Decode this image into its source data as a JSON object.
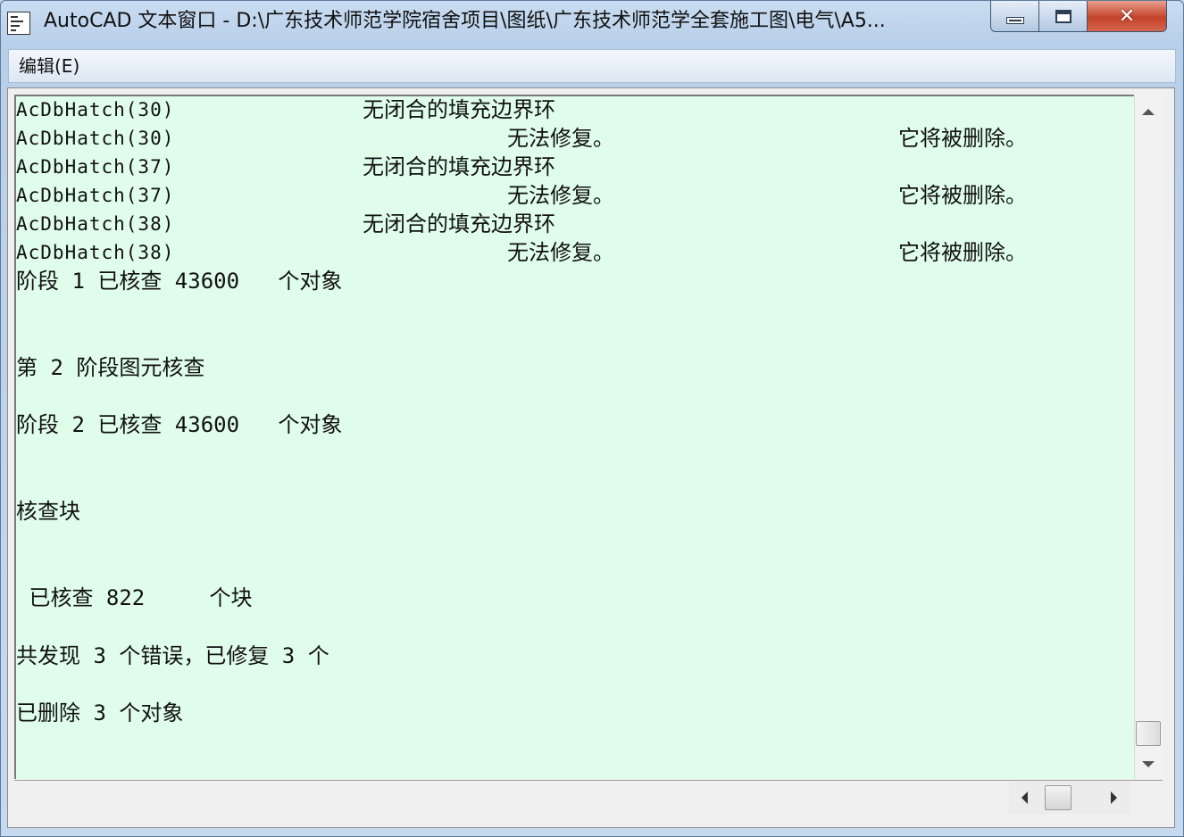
{
  "window": {
    "title": "AutoCAD 文本窗口 - D:\\广东技术师范学院宿舍项目\\图纸\\广东技术师范学全套施工图\\电气\\A5...",
    "title_icon": "text-window-icon",
    "min_icon": "minimize-icon",
    "max_icon": "maximize-icon",
    "close_icon": "close-icon",
    "close_glyph": "✕"
  },
  "menu": {
    "edit_label": "编辑(E)"
  },
  "console": {
    "lines": [
      {
        "a": "AcDbHatch(30)",
        "b": "无闭合的填充边界环",
        "c": ""
      },
      {
        "a": "AcDbHatch(30)",
        "b": "无法修复。",
        "c": "它将被删除。"
      },
      {
        "a": "AcDbHatch(37)",
        "b": "无闭合的填充边界环",
        "c": ""
      },
      {
        "a": "AcDbHatch(37)",
        "b": "无法修复。",
        "c": "它将被删除。"
      },
      {
        "a": "AcDbHatch(38)",
        "b": "无闭合的填充边界环",
        "c": ""
      },
      {
        "a": "AcDbHatch(38)",
        "b": "无法修复。",
        "c": "它将被删除。"
      }
    ],
    "stage1_checked": "阶段 1 已核查 43600   个对象",
    "stage2_header": "第 2 阶段图元核查",
    "stage2_checked": "阶段 2 已核查 43600   个对象",
    "check_blocks": "核查块",
    "blocks_checked": " 已核查 822     个块",
    "errors_summary": "共发现 3 个错误，已修复 3 个",
    "deleted_summary": "已删除 3 个对象"
  },
  "scrollbars": {
    "up_icon": "scroll-up-arrow-icon",
    "down_icon": "scroll-down-arrow-icon",
    "left_icon": "scroll-left-arrow-icon",
    "right_icon": "scroll-right-arrow-icon"
  }
}
